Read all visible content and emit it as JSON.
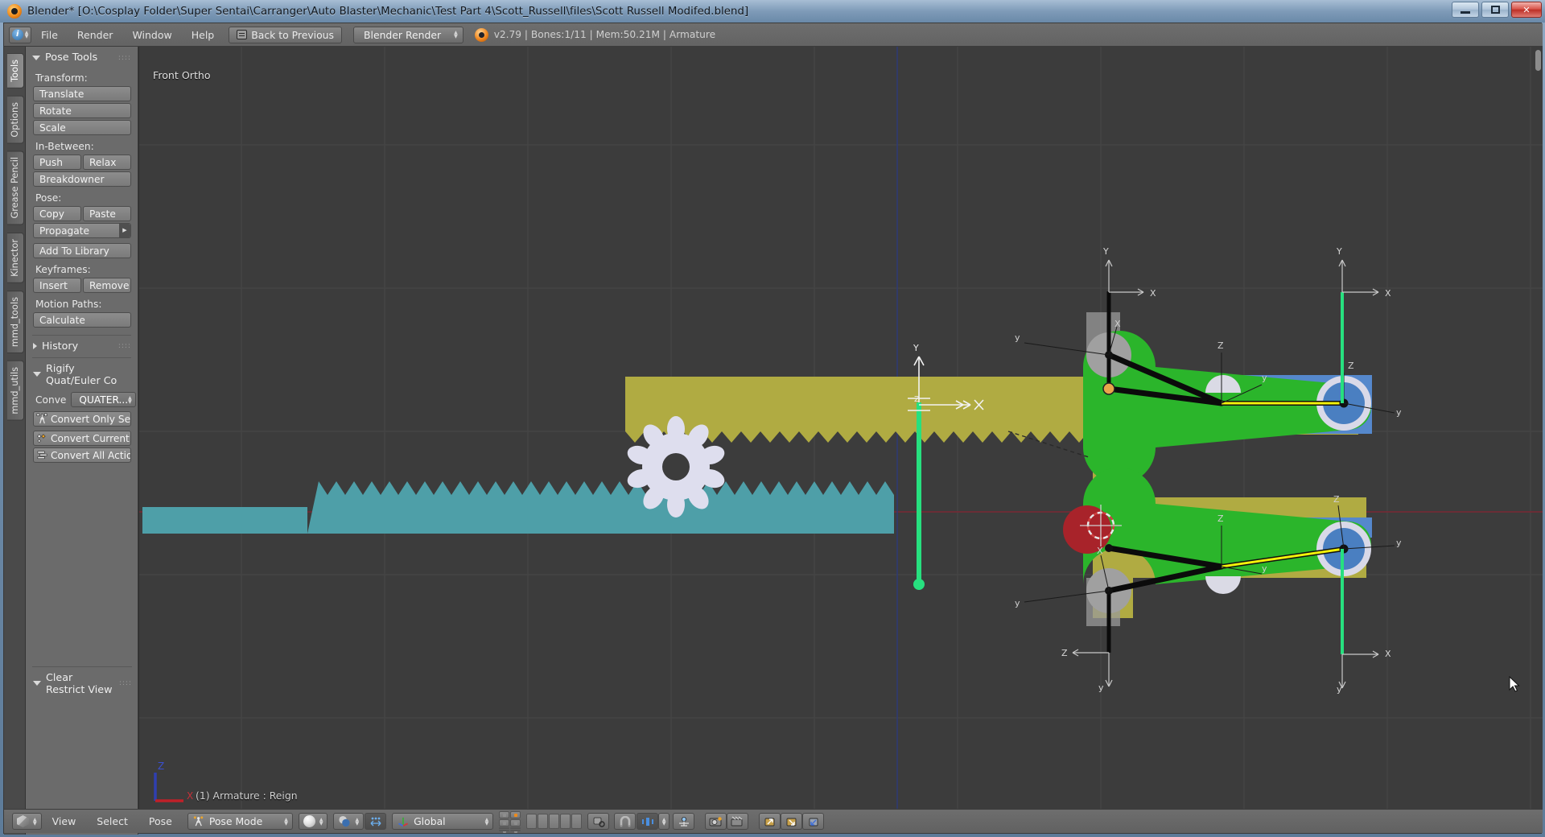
{
  "window": {
    "title": "Blender* [O:\\Cosplay Folder\\Super Sentai\\Carranger\\Auto Blaster\\Mechanic\\Test Part 4\\Scott_Russell\\files\\Scott Russell Modifed.blend]",
    "controls": {
      "minimize": "minimize-button",
      "maximize": "maximize-button",
      "close": "✕"
    }
  },
  "topbar": {
    "editor_icon": "info-editor-icon",
    "menus": [
      "File",
      "Render",
      "Window",
      "Help"
    ],
    "back_button": "Back to Previous",
    "render_engine": "Blender Render",
    "stats": "v2.79 | Bones:1/11  | Mem:50.21M | Armature"
  },
  "tabstrip": {
    "tabs": [
      {
        "label": "Tools",
        "active": true
      },
      {
        "label": "Options",
        "active": false
      },
      {
        "label": "Grease Pencil",
        "active": false
      },
      {
        "label": "Kinector",
        "active": false
      },
      {
        "label": "mmd_tools",
        "active": false
      },
      {
        "label": "mmd_utils",
        "active": false
      }
    ]
  },
  "toolpanel": {
    "pose_tools": {
      "header": "Pose Tools",
      "transform_label": "Transform:",
      "transform_buttons": [
        "Translate",
        "Rotate",
        "Scale"
      ],
      "inbetween_label": "In-Between:",
      "inbetween_buttons": [
        "Push",
        "Relax"
      ],
      "breakdowner": "Breakdowner",
      "pose_label": "Pose:",
      "pose_buttons": [
        "Copy",
        "Paste"
      ],
      "propagate": "Propagate",
      "add_to_library": "Add To Library",
      "keyframes_label": "Keyframes:",
      "keyframe_buttons": [
        "Insert",
        "Remove"
      ],
      "motion_paths_label": "Motion Paths:",
      "calculate": "Calculate"
    },
    "history": {
      "header": "History"
    },
    "rigify": {
      "header": "Rigify Quat/Euler Co",
      "conve_label": "Conve",
      "conve_value": "QUATER...",
      "convert_only_selected": "Convert Only Sele...",
      "convert_current_action": "Convert Current A...",
      "convert_all_actions": "Convert All Actions"
    },
    "clear_restrict_view": {
      "header": "Clear Restrict View"
    }
  },
  "viewport": {
    "view_name": "Front Ortho",
    "object_info": "(1) Armature : Reign",
    "axis_gizmo": {
      "z": "Z",
      "x": "X"
    },
    "bone_axis_labels": {
      "x": "X",
      "y": "Y",
      "z": "Z",
      "xl": "x",
      "yl": "y",
      "zl": "z"
    },
    "colors": {
      "background": "#3c3c3c",
      "rack_upper": "#b0ab42",
      "rack_lower": "#4e9fa8",
      "gear": "#dfdff0",
      "bone_green": "#2bb52b",
      "bone_selected_blue": "#4a7fc1",
      "bone_active_cyan": "#27e07f",
      "plate_blue": "#5588cc",
      "red_axis": "#7a2330",
      "blue_axis": "#2a3a7a",
      "yellow_constraint": "#f2f20a",
      "cursor_red": "#b52020"
    }
  },
  "vpheader": {
    "mode_menus": [
      "View",
      "Select",
      "Pose"
    ],
    "mode": "Pose Mode",
    "viewport_shading": "solid-shading-icon",
    "pivot": "median-point-icon",
    "manipulator_toggle": "manipulator-icon",
    "transform_orientation": "Global",
    "layers_icon": "scene-layers-grid",
    "proportional_edit": "proportional-editing-icon",
    "snap_icon": "magnet-icon",
    "bone_x_mirror": "x-axis-mirror-icon",
    "snap_target": "snap-target-icon",
    "render_icon": "render-camera-icon",
    "render_anim_icon": "render-animation-icon",
    "pose_copy_icon": "copy-pose-icon",
    "pose_paste_icon": "paste-pose-icon",
    "pose_paste_flipped_icon": "paste-flipped-pose-icon"
  }
}
